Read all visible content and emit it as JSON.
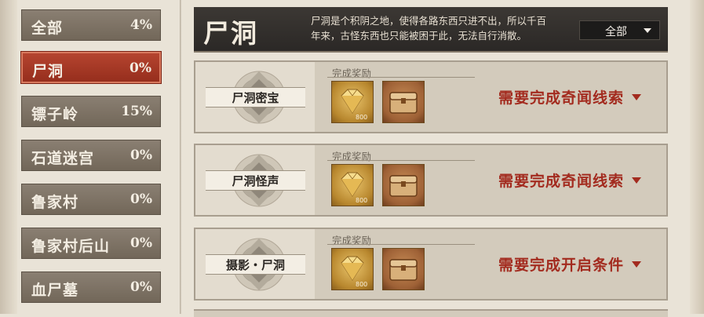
{
  "sidebar": {
    "items": [
      {
        "name": "全部",
        "pct": "4%"
      },
      {
        "name": "尸洞",
        "pct": "0%"
      },
      {
        "name": "镖子岭",
        "pct": "15%"
      },
      {
        "name": "石道迷宫",
        "pct": "0%"
      },
      {
        "name": "鲁家村",
        "pct": "0%"
      },
      {
        "name": "鲁家村后山",
        "pct": "0%"
      },
      {
        "name": "血尸墓",
        "pct": "0%"
      }
    ],
    "active_index": 1
  },
  "header": {
    "title": "尸洞",
    "desc_line1": "尸洞是个积阴之地，使得各路东西只进不出，所以千百",
    "desc_line2": "年来，古怪东西也只能被困于此，无法自行消散。",
    "filter": {
      "value": "全部"
    }
  },
  "quests": [
    {
      "label": "尸洞密宝",
      "rewards_title": "完成奖励",
      "gem_qty": "800",
      "requirement": "需要完成奇闻线索"
    },
    {
      "label": "尸洞怪声",
      "rewards_title": "完成奖励",
      "gem_qty": "800",
      "requirement": "需要完成奇闻线索"
    },
    {
      "label": "摄影・尸洞",
      "rewards_title": "完成奖励",
      "gem_qty": "800",
      "requirement": "需要完成开启条件"
    }
  ],
  "colors": {
    "accent_red": "#a32b1f",
    "active_tab": "#b5442f",
    "header_bg": "#2b2826"
  }
}
